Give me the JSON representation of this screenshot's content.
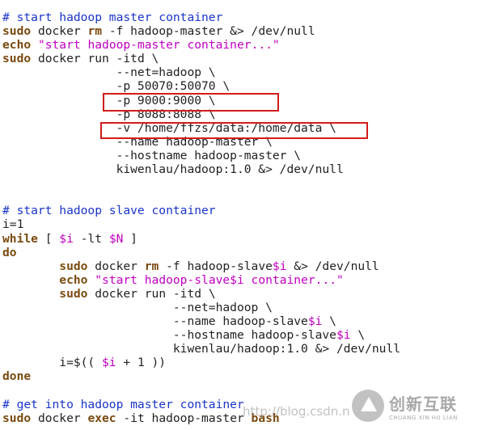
{
  "lines": [
    {
      "segs": [
        {
          "t": "# start hadoop master container",
          "c": "c"
        }
      ]
    },
    {
      "segs": [
        {
          "t": "sudo",
          "c": "k"
        },
        {
          "t": " docker ",
          "c": "p"
        },
        {
          "t": "rm",
          "c": "k"
        },
        {
          "t": " -f hadoop-master &> /dev/null",
          "c": "p"
        }
      ]
    },
    {
      "segs": [
        {
          "t": "echo",
          "c": "k"
        },
        {
          "t": " ",
          "c": "p"
        },
        {
          "t": "\"start hadoop-master container...\"",
          "c": "s"
        }
      ]
    },
    {
      "segs": [
        {
          "t": "sudo",
          "c": "k"
        },
        {
          "t": " docker run -itd \\",
          "c": "p"
        }
      ]
    },
    {
      "segs": [
        {
          "t": "                --net=hadoop \\",
          "c": "p"
        }
      ]
    },
    {
      "segs": [
        {
          "t": "                -p 50070:50070 \\",
          "c": "p"
        }
      ]
    },
    {
      "segs": [
        {
          "t": "                -p 9000:9000 \\",
          "c": "p"
        }
      ]
    },
    {
      "segs": [
        {
          "t": "                -p 8088:8088 \\",
          "c": "p"
        }
      ]
    },
    {
      "segs": [
        {
          "t": "                -v /home/ffzs/data:/home/data \\",
          "c": "p"
        }
      ]
    },
    {
      "segs": [
        {
          "t": "                --name hadoop-master \\",
          "c": "p"
        }
      ]
    },
    {
      "segs": [
        {
          "t": "                --hostname hadoop-master \\",
          "c": "p"
        }
      ]
    },
    {
      "segs": [
        {
          "t": "                kiwenlau/hadoop:1.0 &> /dev/null",
          "c": "p"
        }
      ]
    },
    {
      "segs": [
        {
          "t": "",
          "c": "p"
        }
      ]
    },
    {
      "segs": [
        {
          "t": "",
          "c": "p"
        }
      ]
    },
    {
      "segs": [
        {
          "t": "# start hadoop slave container",
          "c": "c"
        }
      ]
    },
    {
      "segs": [
        {
          "t": "i=1",
          "c": "p"
        }
      ]
    },
    {
      "segs": [
        {
          "t": "while",
          "c": "kw"
        },
        {
          "t": " [ ",
          "c": "p"
        },
        {
          "t": "$i",
          "c": "v"
        },
        {
          "t": " -lt ",
          "c": "p"
        },
        {
          "t": "$N",
          "c": "v"
        },
        {
          "t": " ]",
          "c": "p"
        }
      ]
    },
    {
      "segs": [
        {
          "t": "do",
          "c": "kw"
        }
      ]
    },
    {
      "segs": [
        {
          "t": "        ",
          "c": "p"
        },
        {
          "t": "sudo",
          "c": "k"
        },
        {
          "t": " docker ",
          "c": "p"
        },
        {
          "t": "rm",
          "c": "k"
        },
        {
          "t": " -f hadoop-slave",
          "c": "p"
        },
        {
          "t": "$i",
          "c": "v"
        },
        {
          "t": " &> /dev/null",
          "c": "p"
        }
      ]
    },
    {
      "segs": [
        {
          "t": "        ",
          "c": "p"
        },
        {
          "t": "echo",
          "c": "k"
        },
        {
          "t": " ",
          "c": "p"
        },
        {
          "t": "\"start hadoop-slave$i container...\"",
          "c": "s"
        }
      ]
    },
    {
      "segs": [
        {
          "t": "        ",
          "c": "p"
        },
        {
          "t": "sudo",
          "c": "k"
        },
        {
          "t": " docker run -itd \\",
          "c": "p"
        }
      ]
    },
    {
      "segs": [
        {
          "t": "                        --net=hadoop \\",
          "c": "p"
        }
      ]
    },
    {
      "segs": [
        {
          "t": "                        --name hadoop-slave",
          "c": "p"
        },
        {
          "t": "$i",
          "c": "v"
        },
        {
          "t": " \\",
          "c": "p"
        }
      ]
    },
    {
      "segs": [
        {
          "t": "                        --hostname hadoop-slave",
          "c": "p"
        },
        {
          "t": "$i",
          "c": "v"
        },
        {
          "t": " \\",
          "c": "p"
        }
      ]
    },
    {
      "segs": [
        {
          "t": "                        kiwenlau/hadoop:1.0 &> /dev/null",
          "c": "p"
        }
      ]
    },
    {
      "segs": [
        {
          "t": "        i=$(( ",
          "c": "p"
        },
        {
          "t": "$i",
          "c": "v"
        },
        {
          "t": " + 1 ))",
          "c": "p"
        }
      ]
    },
    {
      "segs": [
        {
          "t": "done",
          "c": "kw"
        }
      ]
    },
    {
      "segs": [
        {
          "t": "",
          "c": "p"
        }
      ]
    },
    {
      "segs": [
        {
          "t": "# get into hadoop master container",
          "c": "c"
        }
      ]
    },
    {
      "segs": [
        {
          "t": "sudo",
          "c": "k"
        },
        {
          "t": " docker ",
          "c": "p"
        },
        {
          "t": "exec",
          "c": "k"
        },
        {
          "t": " -it hadoop-master ",
          "c": "p"
        },
        {
          "t": "bash",
          "c": "k"
        }
      ]
    }
  ],
  "highlight_color": "#d21c1c",
  "watermark": "http://blog.csdn.n",
  "logo": {
    "cn": "创新互联",
    "en": "CHUANG XIN HU LIAN"
  }
}
